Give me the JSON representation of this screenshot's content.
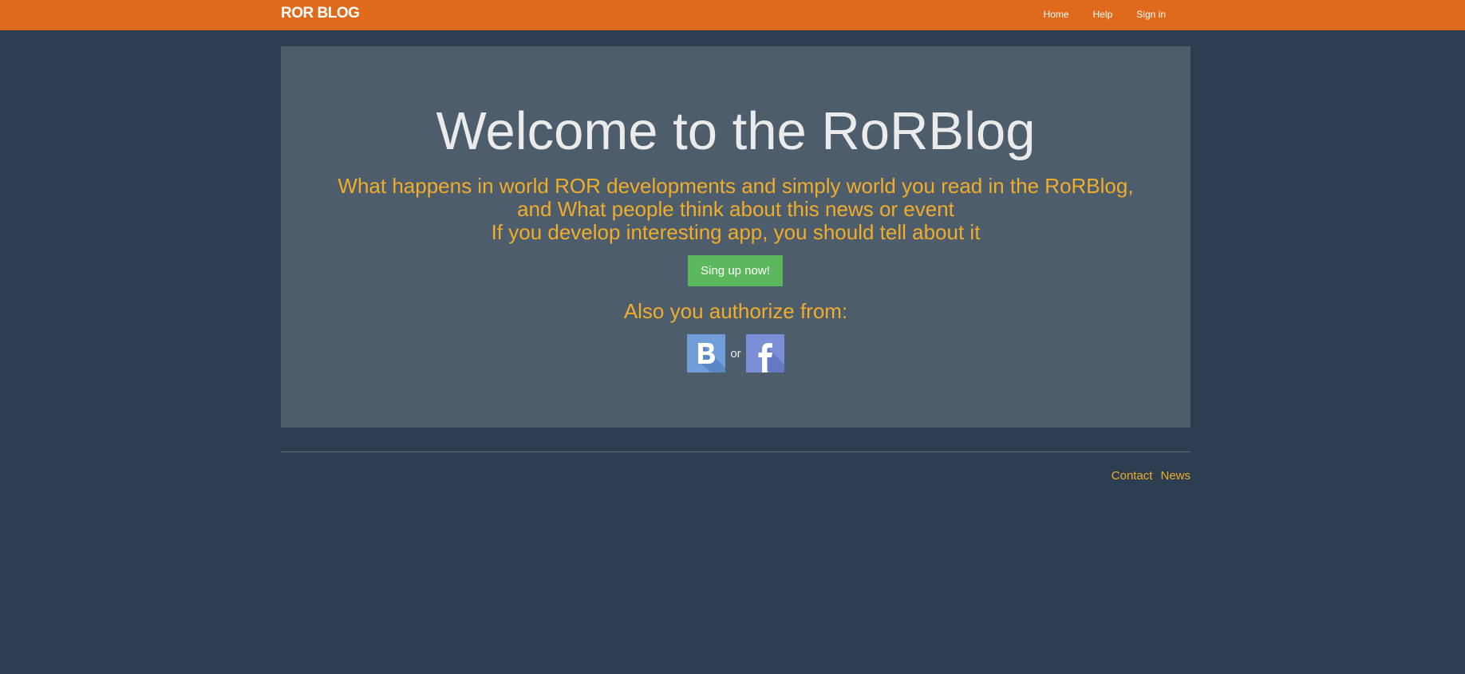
{
  "navbar": {
    "brand": "ROR BLOG",
    "links": [
      {
        "label": "Home"
      },
      {
        "label": "Help"
      },
      {
        "label": "Sign in"
      }
    ],
    "color": "#e06a1b"
  },
  "jumbotron": {
    "title": "Welcome to the RoRBlog",
    "tagline_lines": [
      "What happens in world ROR developments and simply world you read in the RoRBlog,",
      "and What people think about this news or event",
      "If you develop interesting app, you should tell about it"
    ],
    "signup_button": "Sing up now!",
    "auth_heading": "Also you authorize from:",
    "auth_providers": [
      {
        "name": "vkontakte",
        "icon": "vk-b-icon"
      },
      {
        "name": "facebook",
        "icon": "facebook-f-icon"
      }
    ],
    "auth_separator": "or"
  },
  "footer": {
    "links": [
      {
        "label": "Contact"
      },
      {
        "label": "News"
      }
    ]
  },
  "colors": {
    "background": "#2c3e50",
    "panel": "#4e5d6c",
    "accent_text": "#f0ad2a",
    "button": "#5cb85c"
  }
}
